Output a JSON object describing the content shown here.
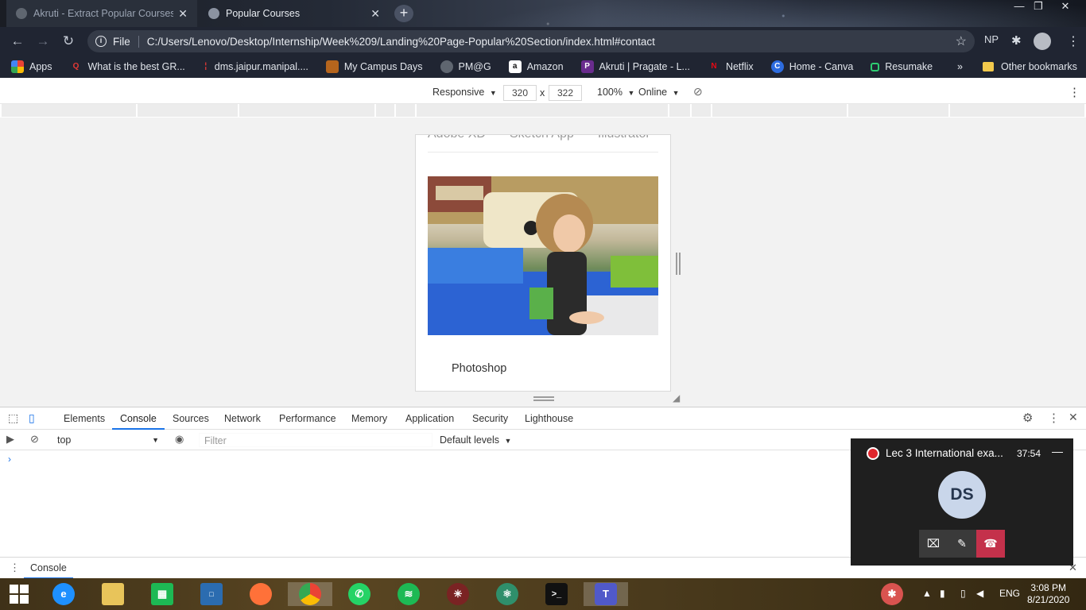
{
  "browser": {
    "tabs": [
      {
        "title": "Akruti - Extract Popular Courses S",
        "active": false
      },
      {
        "title": "Popular Courses",
        "active": true
      }
    ],
    "new_tab": "+",
    "address": {
      "scheme_label": "File",
      "url": "C:/Users/Lenovo/Desktop/Internship/Week%209/Landing%20Page-Popular%20Section/index.html#contact"
    },
    "profile_initials": "NP",
    "bookmarks": [
      {
        "label": "Apps",
        "icon": "apps-grid-icon"
      },
      {
        "label": "What is the best GR...",
        "icon": "quora-icon"
      },
      {
        "label": "dms.jaipur.manipal....",
        "icon": "manipal-icon"
      },
      {
        "label": "My Campus Days",
        "icon": "campus-icon"
      },
      {
        "label": "PM@G",
        "icon": "globe-icon"
      },
      {
        "label": "Amazon",
        "icon": "amazon-icon"
      },
      {
        "label": "Akruti | Pragate - L...",
        "icon": "pragate-icon"
      },
      {
        "label": "Netflix",
        "icon": "netflix-icon"
      },
      {
        "label": "Home - Canva",
        "icon": "canva-icon"
      },
      {
        "label": "Resumake",
        "icon": "resumake-icon"
      }
    ],
    "bookmarks_overflow": "»",
    "other_bookmarks": "Other bookmarks"
  },
  "device_toolbar": {
    "mode": "Responsive",
    "width": "320",
    "height": "322",
    "times": "x",
    "zoom": "100%",
    "network": "Online"
  },
  "page": {
    "course_tabs": [
      "Adobe XD",
      "Sketch App",
      "Illustrator"
    ],
    "card_title": "Photoshop"
  },
  "devtools": {
    "tabs": [
      "Elements",
      "Console",
      "Sources",
      "Network",
      "Performance",
      "Memory",
      "Application",
      "Security",
      "Lighthouse"
    ],
    "active_tab": "Console",
    "context": "top",
    "filter_placeholder": "Filter",
    "levels": "Default levels",
    "prompt": "›",
    "drawer_tab": "Console"
  },
  "call": {
    "title": "Lec 3 International exa...",
    "duration": "37:54",
    "avatar": "DS",
    "minimize": "—"
  },
  "taskbar": {
    "language": "ENG",
    "time": "3:08 PM",
    "date": "8/21/2020"
  },
  "colors": {
    "accent": "#1a73e8",
    "hangup": "#c4314b",
    "record": "#e0262d"
  }
}
